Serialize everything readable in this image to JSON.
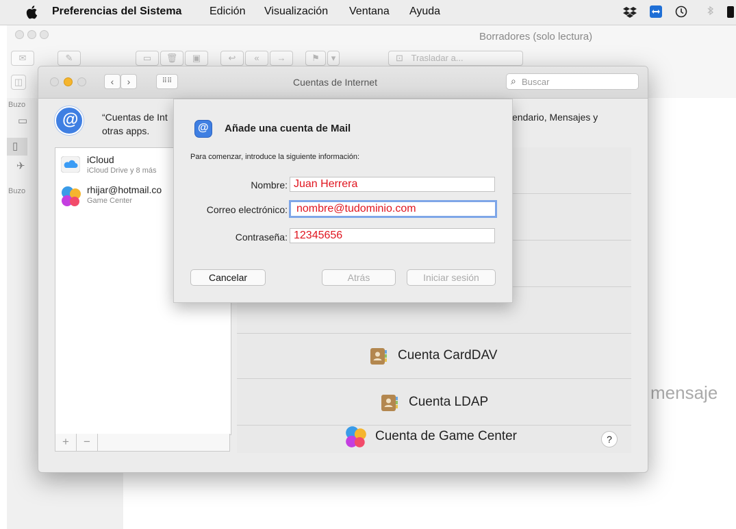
{
  "menubar": {
    "app_name": "Preferencias del Sistema",
    "items": [
      "Edición",
      "Visualización",
      "Ventana",
      "Ayuda"
    ]
  },
  "mail": {
    "window_title": "Borradores (solo lectura)",
    "move_to_label": "Trasladar a...",
    "sidebar_heading_1": "Buzo",
    "sidebar_heading_2": "Buzo",
    "viewer_placeholder": "mensaje"
  },
  "prefs": {
    "title": "Cuentas de Internet",
    "search_placeholder": "Buscar",
    "header_text_left": "“Cuentas de Int",
    "header_text_left_2": "otras apps.",
    "header_text_right": "endario, Mensajes y",
    "accounts": [
      {
        "name": "iCloud",
        "detail": "iCloud Drive y 8 más"
      },
      {
        "name": "rhijar@hotmail.co",
        "detail": "Game Center"
      }
    ],
    "add_label": "+",
    "remove_label": "−",
    "providers": [
      "Cuenta CardDAV",
      "Cuenta LDAP",
      "Cuenta de Game Center"
    ],
    "help_label": "?"
  },
  "sheet": {
    "title": "Añade una cuenta de Mail",
    "intro": "Para comenzar, introduce la siguiente información:",
    "name_label": "Nombre:",
    "name_value": "Juan Herrera",
    "email_label": "Correo electrónico:",
    "email_value": "nombre@tudominio.com",
    "password_label": "Contraseña:",
    "password_value": "12345656",
    "cancel_label": "Cancelar",
    "back_label": "Atrás",
    "signin_label": "Iniciar sesión"
  },
  "colors": {
    "accent_blue": "#3f7fe2",
    "field_text_red": "#e0141e",
    "traffic_yellow": "#f5b52e"
  }
}
